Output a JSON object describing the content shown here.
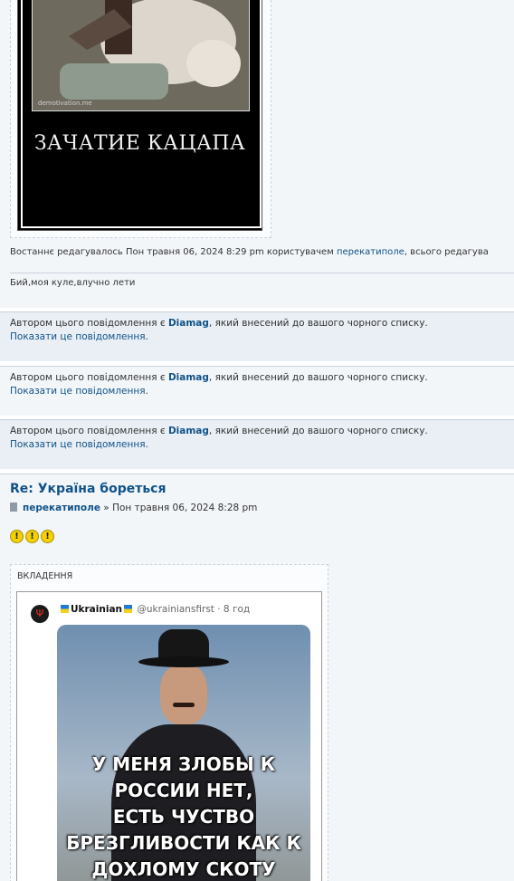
{
  "post1": {
    "image_caption": "ЗАЧАТИЕ КАЦАПА",
    "watermark": "demotivation.me",
    "edit_note_prefix": "Востаннє редагувалось Пон травня 06, 2024 8:29 pm користувачем ",
    "edit_user": "перекатиполе",
    "edit_note_suffix": ", всього редагува",
    "signature": "Бий,моя куле,влучно лети"
  },
  "blocked_posts": [
    {
      "text_prefix": "Автором цього повідомлення є ",
      "author": "Diamag",
      "text_suffix": ", який внесений до вашого чорного списку.",
      "link": "Показати це повідомлення",
      "link_suffix": "."
    },
    {
      "text_prefix": "Автором цього повідомлення є ",
      "author": "Diamag",
      "text_suffix": ", який внесений до вашого чорного списку.",
      "link": "Показати це повідомлення",
      "link_suffix": "."
    },
    {
      "text_prefix": "Автором цього повідомлення є ",
      "author": "Diamag",
      "text_suffix": ", який внесений до вашого чорного списку.",
      "link": "Показати це повідомлення",
      "link_suffix": "."
    }
  ],
  "post2": {
    "title": "Re: Україна бореться",
    "author": "перекатиполе",
    "meta_sep": " » ",
    "date": "Пон травня 06, 2024 8:28 pm",
    "smileys": [
      "!",
      "!",
      "!"
    ],
    "attachments_label": "ВКЛАДЕННЯ",
    "tweet": {
      "name": "Ukrainian",
      "handle": "@ukrainiansfirst · 8 год",
      "image_text": [
        "У МЕНЯ ЗЛОБЫ К",
        "РОССИИ НЕТ,",
        "ЕСТЬ ЧУСТВО",
        "БРЕЗГЛИВОСТИ КАК К",
        "ДОХЛОМУ СКОТУ"
      ]
    }
  },
  "colors": {
    "link": "#105289",
    "bg_post": "#f3f6f9",
    "bg_blocked": "#e9eff5"
  }
}
